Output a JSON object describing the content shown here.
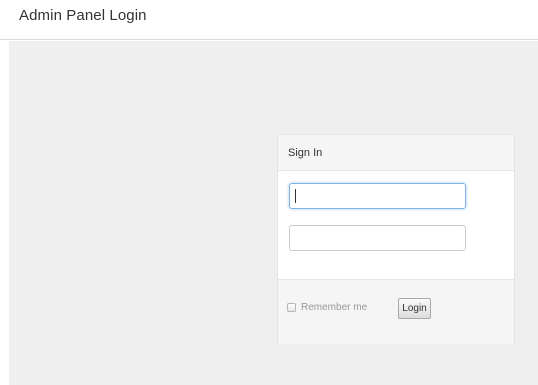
{
  "header": {
    "title": "Admin Panel Login"
  },
  "login_panel": {
    "title": "Sign In",
    "username": {
      "value": "",
      "placeholder": ""
    },
    "password": {
      "value": "",
      "placeholder": ""
    },
    "remember_label": "Remember me",
    "remember_checked": false,
    "login_label": "Login"
  }
}
